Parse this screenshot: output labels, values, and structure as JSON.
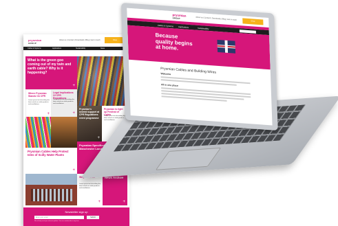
{
  "brand": {
    "name": "prysmian",
    "group": "GROUP",
    "accent": "#d6167a",
    "promo_color": "#f6b21b"
  },
  "page": {
    "nav_items": [
      "Cables & Systems",
      "Applications",
      "Sustainability",
      "News"
    ],
    "top_links": "About us | Contact | Downloads | Blog | Get in touch",
    "promo": "Shop",
    "tiles": {
      "hero": "What is the green goo coming out of my twin and earth cable? Why is it happening?",
      "white_a": "Where Prysmian Stands On CPR",
      "gray_1": "Legal Implications Of CPR Regulations",
      "mid_pink": "Prysmian to light up Festival of Lights",
      "sequin": "Prysmian's newest support at CPR Regulations event programme",
      "wide_white": "Prysmian Cables Help Protect Isles of Scilly Water Plants",
      "dark_pink": "Prysmian Specified For Iconic Manchester Landmark",
      "white_b": "Wrights Tower",
      "news_archive": "News Archive",
      "body_filler": "Lorem ipsum text describing the latest article on cable products and installations."
    },
    "newsletter": {
      "title": "Newsletter sign up",
      "placeholder": "Enter your email",
      "button": "Submit",
      "fine_print": "We will only send you relevant updates. You can unsubscribe at any time."
    }
  },
  "laptop": {
    "top_links": "About us | Contact | Downloads | Blog | Get in touch",
    "promo": "Shop",
    "nav_items": [
      "Cables & Systems",
      "Applications",
      "Sustainability"
    ],
    "hero_line1": "Because",
    "hero_line2": "quality begins",
    "hero_line3": "at home.",
    "heading": "Prysmian Cables and Building Wires",
    "welcome": "Welcome",
    "subheading": "All in one place"
  }
}
